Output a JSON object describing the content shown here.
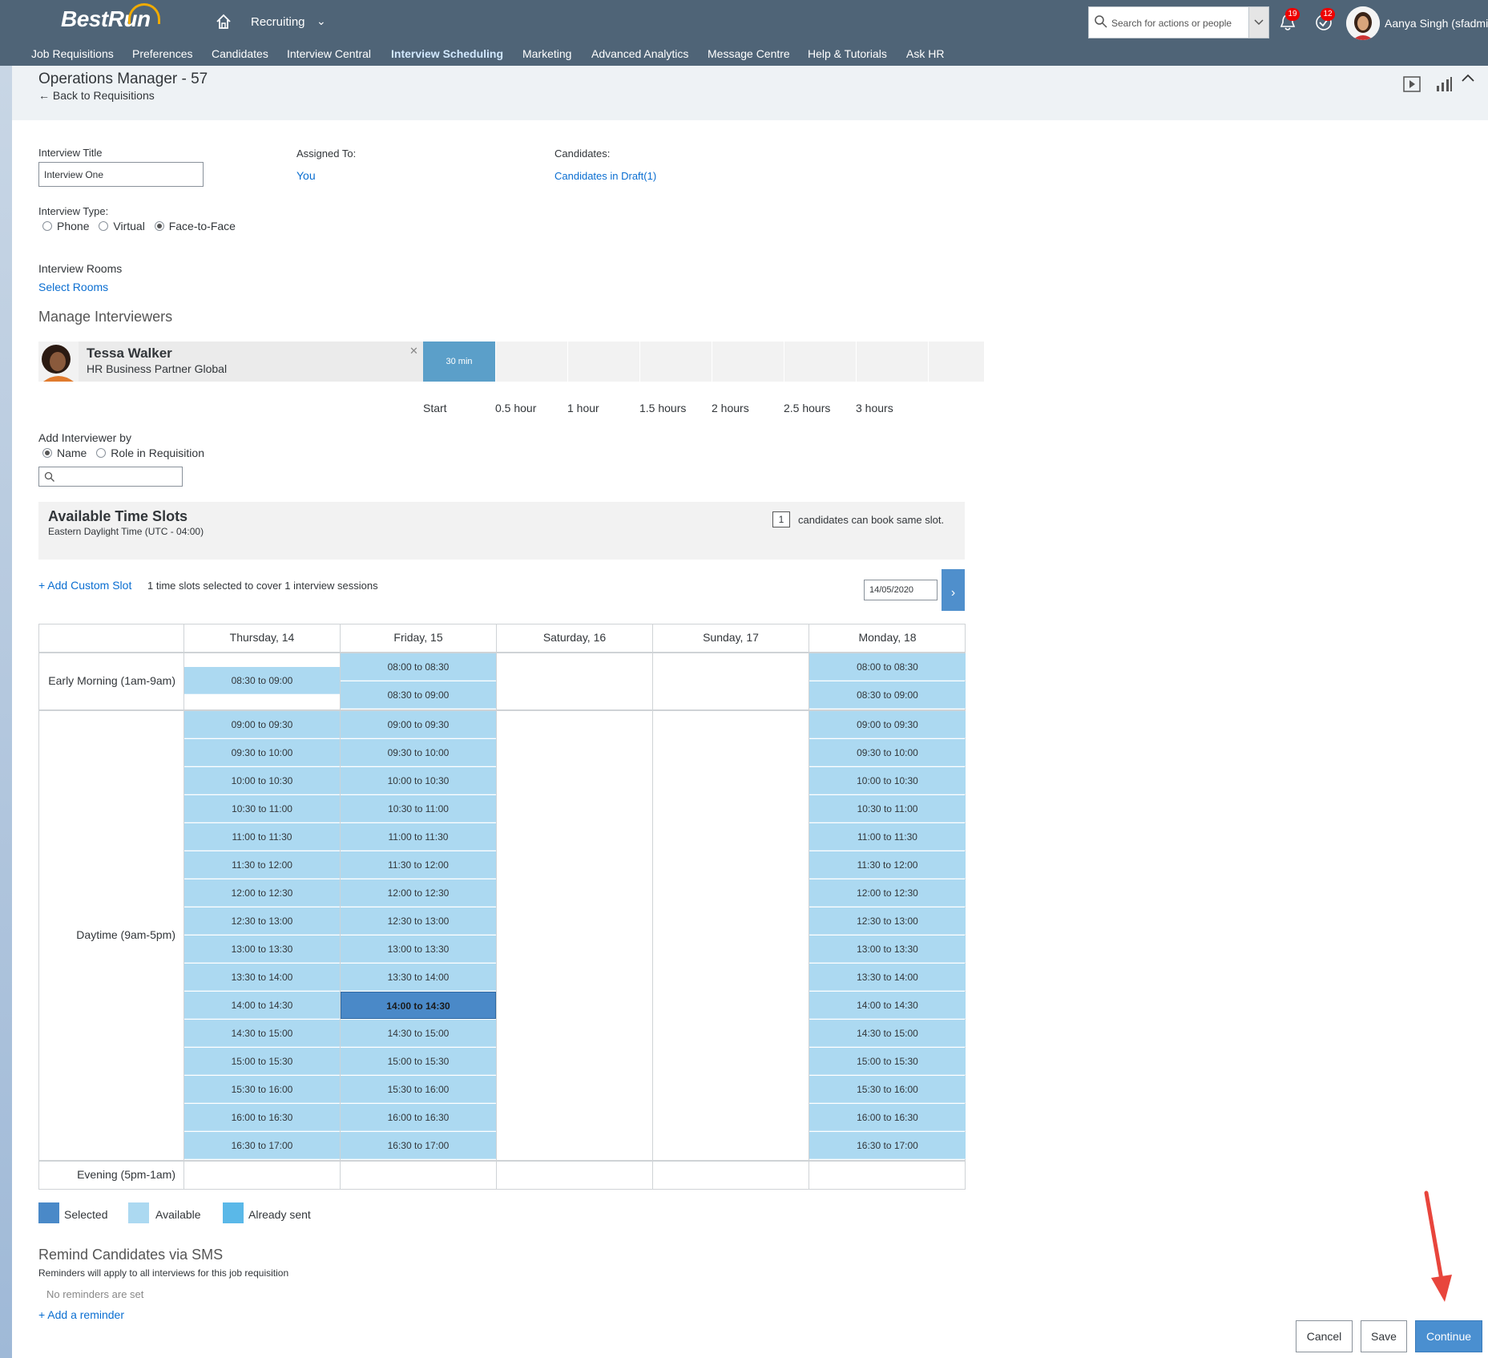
{
  "app": {
    "logo": "BestRun",
    "module": "Recruiting",
    "search_placeholder": "Search for actions or people",
    "notifications_count": "19",
    "todo_count": "12",
    "user_name": "Aanya Singh (sfadmi"
  },
  "nav": [
    {
      "label": "Job Requisitions"
    },
    {
      "label": "Preferences"
    },
    {
      "label": "Candidates"
    },
    {
      "label": "Interview Central"
    },
    {
      "label": "Interview Scheduling"
    },
    {
      "label": "Marketing"
    },
    {
      "label": "Advanced Analytics"
    },
    {
      "label": "Message Centre"
    },
    {
      "label": "Help & Tutorials"
    },
    {
      "label": "Ask HR"
    }
  ],
  "header": {
    "title": "Operations Manager - 57",
    "back": "Back to Requisitions"
  },
  "form": {
    "title_label": "Interview Title",
    "title_value": "Interview One",
    "assigned_label": "Assigned To:",
    "assigned_value": "You",
    "candidates_label": "Candidates:",
    "candidates_value": "Candidates in Draft(1)",
    "type_label": "Interview Type:",
    "type_options": [
      "Phone",
      "Virtual",
      "Face-to-Face"
    ],
    "type_selected": "Face-to-Face",
    "rooms_label": "Interview Rooms",
    "rooms_link": "Select Rooms"
  },
  "interviewers": {
    "heading": "Manage Interviewers",
    "name": "Tessa Walker",
    "role": "HR Business Partner Global",
    "duration": "30 min",
    "timeline": [
      "Start",
      "0.5 hour",
      "1 hour",
      "1.5 hours",
      "2 hours",
      "2.5 hours",
      "3 hours"
    ],
    "add_by_label": "Add Interviewer by",
    "add_by_options": [
      "Name",
      "Role in Requisition"
    ],
    "add_by_selected": "Name"
  },
  "slots": {
    "heading": "Available Time Slots",
    "timezone": "Eastern Daylight Time (UTC - 04:00)",
    "same_slot_count": "1",
    "same_slot_label": "candidates can book same slot.",
    "add_custom": "+ Add Custom Slot",
    "summary": "1 time slots selected to cover 1 interview sessions",
    "date_value": "14/05/2020",
    "days": [
      "Thursday, 14",
      "Friday, 15",
      "Saturday, 16",
      "Sunday, 17",
      "Monday, 18"
    ],
    "rows": [
      "Early Morning (1am-9am)",
      "Daytime (9am-5pm)",
      "Evening (5pm-1am)"
    ],
    "early": {
      "thursday": [
        "08:30 to 09:00"
      ],
      "friday": [
        "08:00 to 08:30",
        "08:30 to 09:00"
      ],
      "monday": [
        "08:00 to 08:30",
        "08:30 to 09:00"
      ]
    },
    "daytime": [
      "09:00 to 09:30",
      "09:30 to 10:00",
      "10:00 to 10:30",
      "10:30 to 11:00",
      "11:00 to 11:30",
      "11:30 to 12:00",
      "12:00 to 12:30",
      "12:30 to 13:00",
      "13:00 to 13:30",
      "13:30 to 14:00",
      "14:00 to 14:30",
      "14:30 to 15:00",
      "15:00 to 15:30",
      "15:30 to 16:00",
      "16:00 to 16:30",
      "16:30 to 17:00"
    ],
    "selected": "Friday 14:00 to 14:30",
    "legend": [
      "Selected",
      "Available",
      "Already sent"
    ],
    "colors": {
      "selected": "#4a89c8",
      "available": "#acd9f1",
      "sent": "#5ab8e8"
    }
  },
  "remind": {
    "heading": "Remind Candidates via SMS",
    "sub": "Reminders will apply to all interviews for this job requisition",
    "none": "No reminders are set",
    "add": "+ Add a reminder"
  },
  "footer": {
    "cancel": "Cancel",
    "save": "Save",
    "continue": "Continue"
  }
}
